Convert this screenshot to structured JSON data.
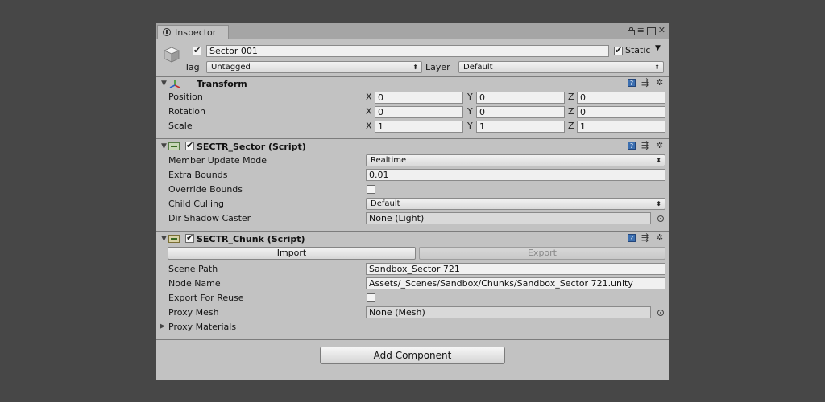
{
  "window": {
    "tab_label": "Inspector",
    "icons": [
      "lock-icon",
      "menu-icon",
      "maximize-icon",
      "close-icon"
    ]
  },
  "gameobject": {
    "active": true,
    "name": "Sector 001",
    "static_checked": true,
    "static_label": "Static",
    "tag_label": "Tag",
    "tag_value": "Untagged",
    "layer_label": "Layer",
    "layer_value": "Default"
  },
  "transform": {
    "title": "Transform",
    "rows": [
      {
        "label": "Position",
        "x": "0",
        "y": "0",
        "z": "0"
      },
      {
        "label": "Rotation",
        "x": "0",
        "y": "0",
        "z": "0"
      },
      {
        "label": "Scale",
        "x": "1",
        "y": "1",
        "z": "1"
      }
    ],
    "axis_labels": {
      "x": "X",
      "y": "Y",
      "z": "Z"
    }
  },
  "sector": {
    "title": "SECTR_Sector (Script)",
    "enabled": true,
    "member_update_mode_label": "Member Update Mode",
    "member_update_mode_value": "Realtime",
    "extra_bounds_label": "Extra Bounds",
    "extra_bounds_value": "0.01",
    "override_bounds_label": "Override Bounds",
    "override_bounds_checked": false,
    "child_culling_label": "Child Culling",
    "child_culling_value": "Default",
    "dir_shadow_caster_label": "Dir Shadow Caster",
    "dir_shadow_caster_value": "None (Light)"
  },
  "chunk": {
    "title": "SECTR_Chunk (Script)",
    "enabled": true,
    "import_label": "Import",
    "export_label": "Export",
    "scene_path_label": "Scene Path",
    "scene_path_value": "Sandbox_Sector 721",
    "node_name_label": "Node Name",
    "node_name_value": "Assets/_Scenes/Sandbox/Chunks/Sandbox_Sector 721.unity",
    "export_for_reuse_label": "Export For Reuse",
    "export_for_reuse_checked": false,
    "proxy_mesh_label": "Proxy Mesh",
    "proxy_mesh_value": "None (Mesh)",
    "proxy_materials_label": "Proxy Materials"
  },
  "add_component_label": "Add Component",
  "colors": {
    "background": "#474747",
    "panel": "#c2c2c2",
    "help_icon": "#3c6fb0"
  }
}
